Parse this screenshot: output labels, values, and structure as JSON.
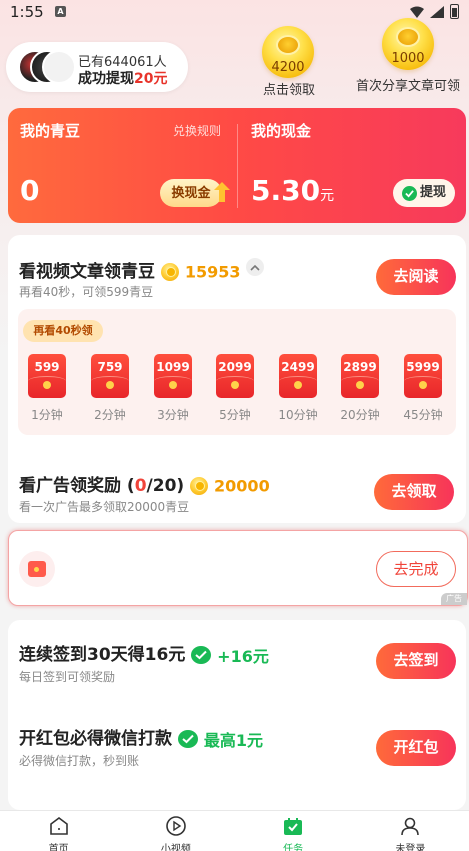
{
  "status": {
    "time": "1:55",
    "a_icon": "A"
  },
  "header": {
    "withdraw_count": "已有644061人",
    "withdraw_text": "成功提现",
    "withdraw_amount": "20元",
    "coin1_amount": "4200",
    "coin1_caption": "点击领取",
    "coin2_amount": "1000",
    "coin2_caption": "首次分享文章可领"
  },
  "balance": {
    "beans_label": "我的青豆",
    "rules_link": "兑换规则",
    "beans_value": "0",
    "exchange_button": "换现金",
    "cash_label": "我的现金",
    "cash_value": "5.30",
    "cash_unit": "元",
    "withdraw_button": "提现"
  },
  "video_task": {
    "title": "看视频文章领青豆",
    "coins": "15953",
    "subtitle": "再看40秒，可领599青豆",
    "button": "去阅读",
    "timer_label": "再看40秒领",
    "packets": [
      {
        "amount": "599",
        "label": "1分钟"
      },
      {
        "amount": "759",
        "label": "2分钟"
      },
      {
        "amount": "1099",
        "label": "3分钟"
      },
      {
        "amount": "2099",
        "label": "5分钟"
      },
      {
        "amount": "2499",
        "label": "10分钟"
      },
      {
        "amount": "2899",
        "label": "20分钟"
      },
      {
        "amount": "5999",
        "label": "45分钟"
      }
    ]
  },
  "ad_task": {
    "title_prefix": "看广告领奖励 (",
    "progress_done": "0",
    "progress_total": "/20)",
    "coins": "20000",
    "subtitle": "看一次广告最多领取20000青豆",
    "button": "去领取"
  },
  "promo": {
    "button": "去完成",
    "ad_tag": "广告"
  },
  "sign_task": {
    "title": "连续签到30天得16元",
    "bonus": "+16元",
    "subtitle": "每日签到可领奖励",
    "button": "去签到"
  },
  "redpack_task": {
    "title": "开红包必得微信打款",
    "bonus": "最高1元",
    "subtitle": "必得微信打款，秒到账",
    "button": "开红包"
  },
  "nav": [
    {
      "label": "首页",
      "icon": "home-icon"
    },
    {
      "label": "小视频",
      "icon": "play-circle-icon"
    },
    {
      "label": "任务",
      "icon": "task-bag-icon"
    },
    {
      "label": "未登录",
      "icon": "user-icon"
    }
  ],
  "colors": {
    "accent_red": "#f7345a",
    "accent_orange": "#ff6a3a",
    "green": "#19b955",
    "gold": "#f29b00"
  }
}
